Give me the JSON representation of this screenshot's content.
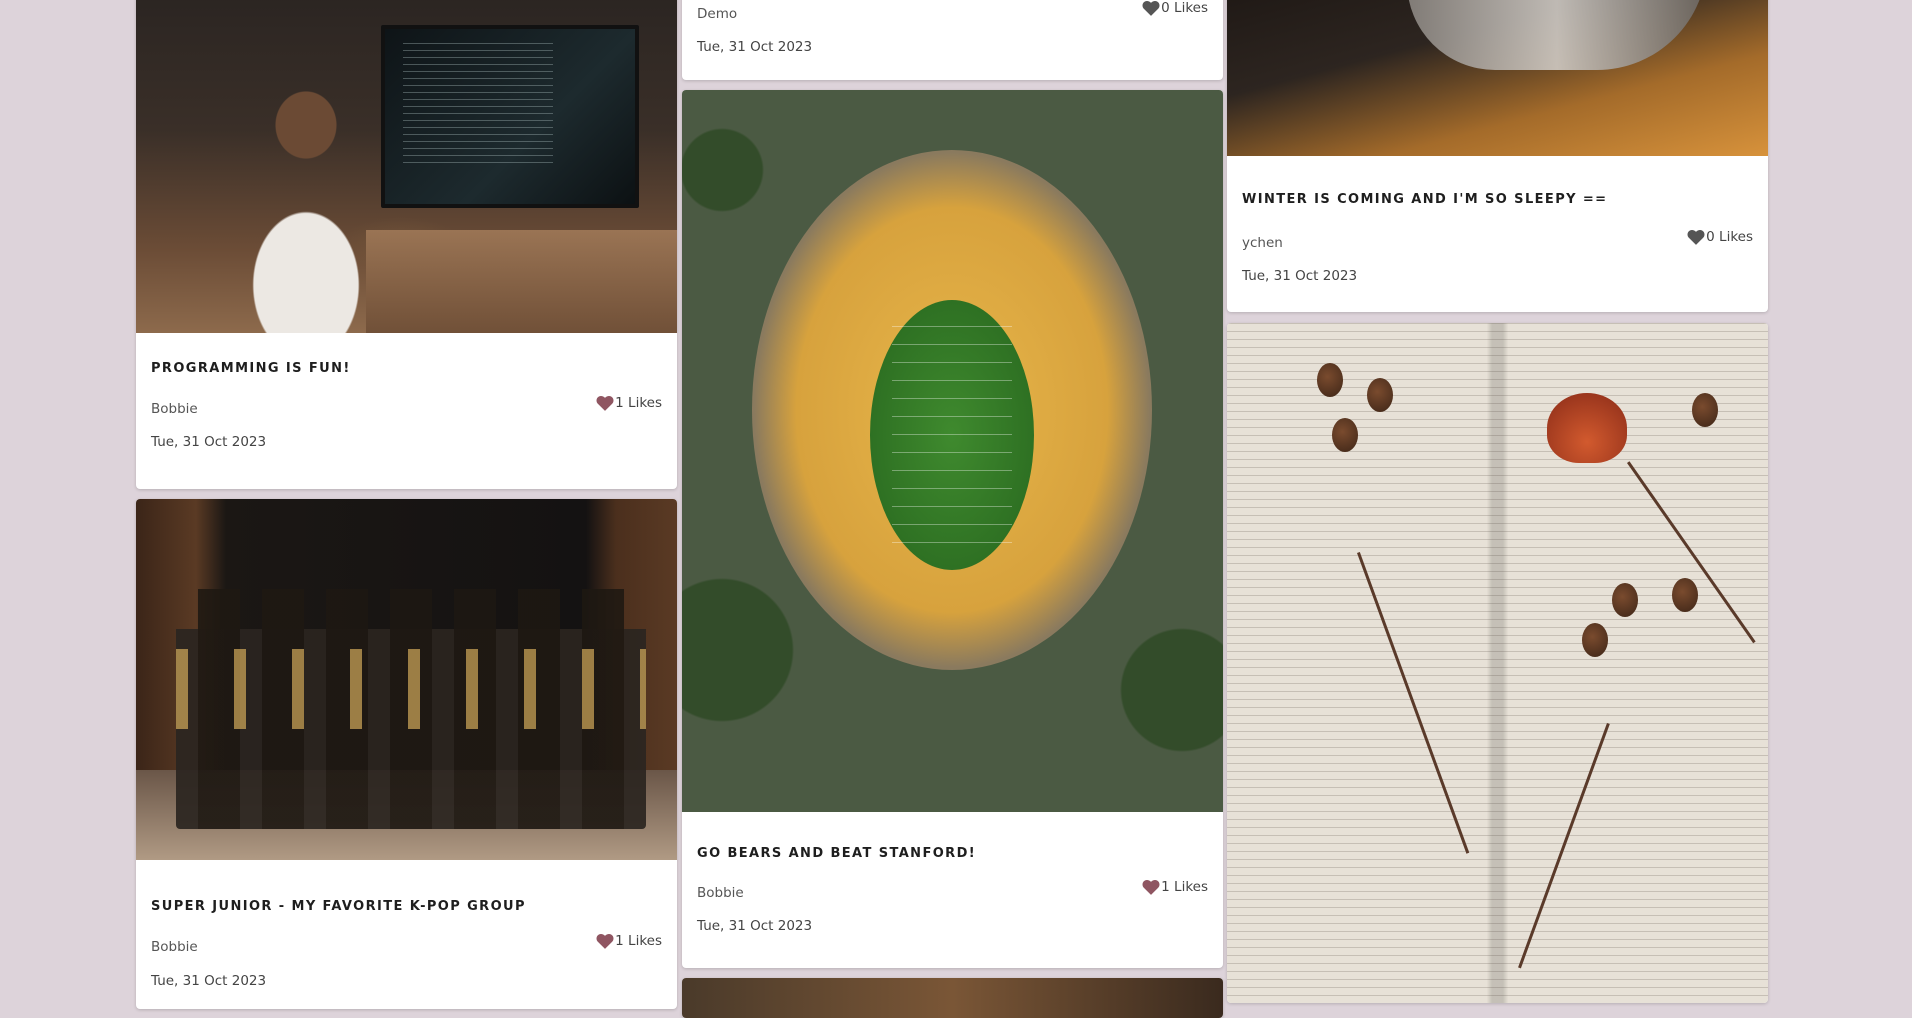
{
  "colors": {
    "page_background": "#ddd3da",
    "heart": "#8f5561",
    "heart_empty": "#555555"
  },
  "cards": {
    "programming": {
      "title": "PROGRAMMING IS FUN!",
      "author": "Bobbie",
      "likes": "1 Likes",
      "date": "Tue, 31 Oct 2023",
      "liked": true
    },
    "superjunior": {
      "title": "SUPER JUNIOR - MY FAVORITE K-POP GROUP",
      "author": "Bobbie",
      "likes": "1 Likes",
      "date": "Tue, 31 Oct 2023",
      "liked": true
    },
    "demo": {
      "author": "Demo",
      "likes": "0 Likes",
      "date": "Tue, 31 Oct 2023",
      "liked": false
    },
    "gobears": {
      "title": "GO BEARS AND BEAT STANFORD!",
      "author": "Bobbie",
      "likes": "1 Likes",
      "date": "Tue, 31 Oct 2023",
      "liked": true
    },
    "winter": {
      "title": "WINTER IS COMING AND I'M SO SLEEPY ==",
      "author": "ychen",
      "likes": "0 Likes",
      "date": "Tue, 31 Oct 2023",
      "liked": false
    }
  },
  "icons": {
    "like": "heart-icon"
  }
}
